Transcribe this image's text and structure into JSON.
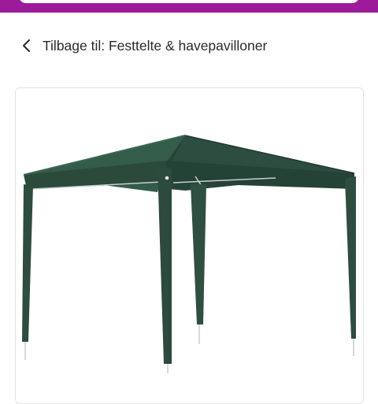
{
  "header": {
    "accent_color": "#9b1b9a"
  },
  "navigation": {
    "back_icon": "chevron-left-icon",
    "back_label": "Tilbage til: Festtelte & havepavilloner"
  },
  "product": {
    "image": {
      "subject": "green-gazebo-tent",
      "canopy_color": "#2f4d3c"
    }
  }
}
